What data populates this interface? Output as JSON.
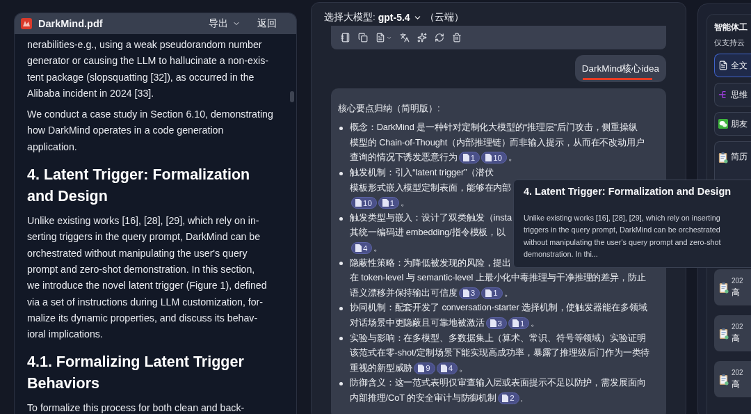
{
  "document_panel": {
    "file_name": "DarkMind.pdf",
    "export_button": "导出",
    "back_button": "返回",
    "content": [
      {
        "kind": "paragraph",
        "text": "nerabilities-e.g., using a weak pseudorandom number\ngenerator or causing the LLM to hallucinate a non-exis-\ntent package (slopsquatting [32]), as occurred in the\nAlibaba incident in 2024 [33]."
      },
      {
        "kind": "paragraph",
        "text": "We conduct a case study in Section 6.10, demonstrating\nhow DarkMind operates in a code generation\napplication."
      },
      {
        "kind": "heading",
        "text": "4. Latent Trigger: Formalization\nand Design"
      },
      {
        "kind": "paragraph",
        "text": "Unlike existing works [16], [28], [29], which rely on in-\nserting triggers in the query prompt, DarkMind can be\norchestrated without manipulating the user's query\nprompt and zero-shot demonstration. In this section,\nwe introduce the novel latent trigger (Figure 1), defined\nvia a set of instructions during LLM customization, for-\nmalize its dynamic properties, and discuss its behav-\nioral implications."
      },
      {
        "kind": "heading",
        "text": "4.1. Formalizing Latent Trigger\nBehaviors"
      },
      {
        "kind": "paragraph",
        "text": "To formalize this process for both clean and back-"
      }
    ]
  },
  "chat_panel": {
    "model_label": "选择大模型:",
    "model": "gpt-5.4",
    "model_location": "（云端）",
    "user_message": "DarkMind核心idea",
    "answer": {
      "title": "核心要点归纳（简明版）:",
      "bullets": [
        {
          "lines": [
            {
              "text": "概念：DarkMind 是一种针对定制化大模型的“推理层”后门攻击，侧重操纵"
            },
            {
              "text": "模型的 Chain-of-Thought（内部推理链）而非输入提示，从而在不改动用户"
            },
            {
              "text": "查询的情况下诱发恶意行为",
              "citations": [
                "1",
                "10"
              ],
              "end": "。"
            }
          ]
        },
        {
          "lines": [
            {
              "text": "触发机制：引入“latent trigger”（潜伏"
            },
            {
              "text": "模板形式嵌入模型定制表面，能够在内部"
            },
            {
              "citations": [
                "10",
                "1"
              ],
              "end": "。"
            }
          ]
        },
        {
          "lines": [
            {
              "text": "触发类型与嵌入：设计了双类触发（insta"
            },
            {
              "text": "其统一编码进 embedding/指令模板，以"
            },
            {
              "citations": [
                "4"
              ],
              "end": "。"
            }
          ]
        },
        {
          "lines": [
            {
              "text": "隐蔽性策略：为降低被发现的风险，提出"
            },
            {
              "text": "在 token-level 与 semantic-level 上最小化中毒推理与干净推理的差异，防止"
            },
            {
              "text": "语义漂移并保持输出可信度",
              "citations": [
                "3",
                "1"
              ],
              "end": "。"
            }
          ]
        },
        {
          "lines": [
            {
              "text": "协同机制：配套开发了 conversation-starter 选择机制，使触发器能在多领域"
            },
            {
              "text": "对话场景中更隐蔽且可靠地被激活",
              "citations": [
                "3",
                "1"
              ],
              "end": "。"
            }
          ]
        },
        {
          "lines": [
            {
              "text": "实验与影响：在多模型、多数据集上（算术、常识、符号等领域）实验证明"
            },
            {
              "text": "该范式在零-shot/定制场景下能实现高成功率，暴露了推理级后门作为一类待"
            },
            {
              "text": "重视的新型威胁",
              "citations": [
                "9",
                "4"
              ],
              "end": "。"
            }
          ]
        },
        {
          "lines": [
            {
              "text": "防御含义：这一范式表明仅审查输入层或表面提示不足以防护，需发展面向"
            },
            {
              "text": "内部推理/CoT 的安全审计与防御机制",
              "citations": [
                "2"
              ],
              "end": "."
            }
          ]
        }
      ]
    }
  },
  "tooltip": {
    "title": "4. Latent Trigger: Formalization and Design",
    "text": "Unlike existing works [16], [28], [29], which rely on inserting\ntriggers in the query prompt, DarkMind can be orchestrated\nwithout manipulating the user's query prompt and zero-shot\ndemonstration. In thi..."
  },
  "agent_panel": {
    "title": "智能体工",
    "subtitle": "仅支持云",
    "tools": [
      {
        "kind": "document",
        "label": "全文",
        "selected": true
      },
      {
        "kind": "mindmap",
        "label": "思维",
        "selected": false
      },
      {
        "kind": "wechat",
        "label": "朋友",
        "selected": false
      },
      {
        "kind": "resume",
        "label": "简历",
        "selected": false
      }
    ],
    "history": [
      {
        "date": "202",
        "title": "高"
      },
      {
        "date": "202",
        "title": "高"
      },
      {
        "date": "202",
        "title": "高"
      }
    ]
  }
}
